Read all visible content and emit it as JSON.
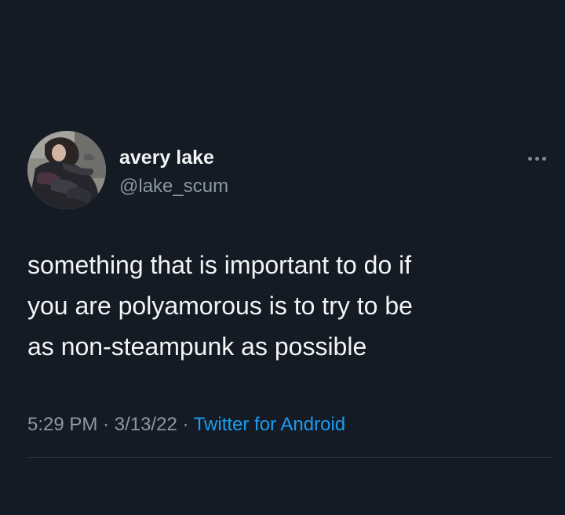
{
  "user": {
    "display_name": "avery lake",
    "handle": "@lake_scum",
    "avatar_icon": "profile-photo"
  },
  "more_icon": "more-horizontal-icon",
  "tweet": {
    "text": "something that is important to do if\nyou are polyamorous is to try to be\nas non-steampunk as possible",
    "time": "5:29 PM",
    "separator": " · ",
    "date": "3/13/22",
    "source": "Twitter for Android"
  },
  "colors": {
    "background": "#141b24",
    "text": "#f2f4f6",
    "secondary_text": "#8b98a5",
    "link": "#1d9bf0"
  }
}
